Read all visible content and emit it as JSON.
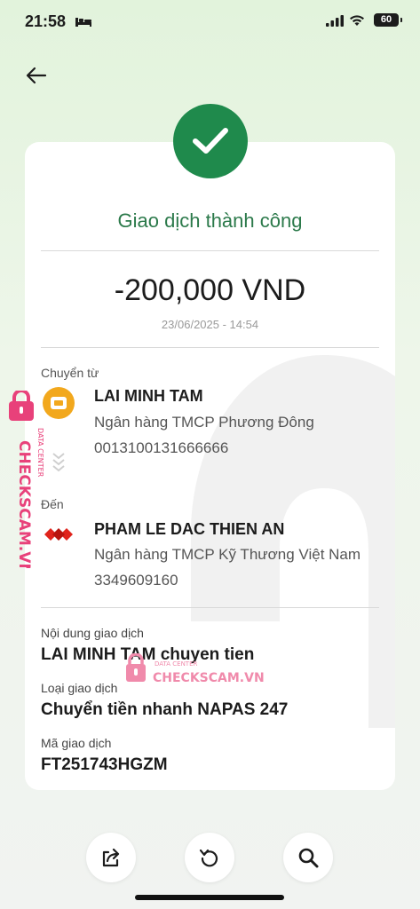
{
  "status_bar": {
    "time": "21:58",
    "battery": "60"
  },
  "transaction": {
    "status_title": "Giao dịch thành công",
    "amount": "-200,000 VND",
    "datetime": "23/06/2025 - 14:54"
  },
  "sender": {
    "label": "Chuyển từ",
    "name": "LAI MINH TAM",
    "bank": "Ngân hàng TMCP Phương Đông",
    "account": "0013100131666666"
  },
  "receiver": {
    "label": "Đến",
    "name": "PHAM LE DAC THIEN AN",
    "bank": "Ngân hàng TMCP Kỹ Thương Việt Nam",
    "account": "3349609160"
  },
  "details": {
    "content_label": "Nội dung giao dịch",
    "content_value": "LAI MINH TAM chuyen tien",
    "type_label": "Loại giao dịch",
    "type_value": "Chuyển tiền nhanh NAPAS 247",
    "code_label": "Mã giao dịch",
    "code_value": "FT251743HGZM"
  },
  "watermark": {
    "top": "DATA CENTER",
    "bottom": "CHECKSCAM.VN"
  },
  "colors": {
    "success_green": "#1f8a4c",
    "title_green": "#2c7a4b",
    "watermark_pink": "#e8417a"
  },
  "actions": [
    "share-icon",
    "repeat-icon",
    "search-icon"
  ]
}
